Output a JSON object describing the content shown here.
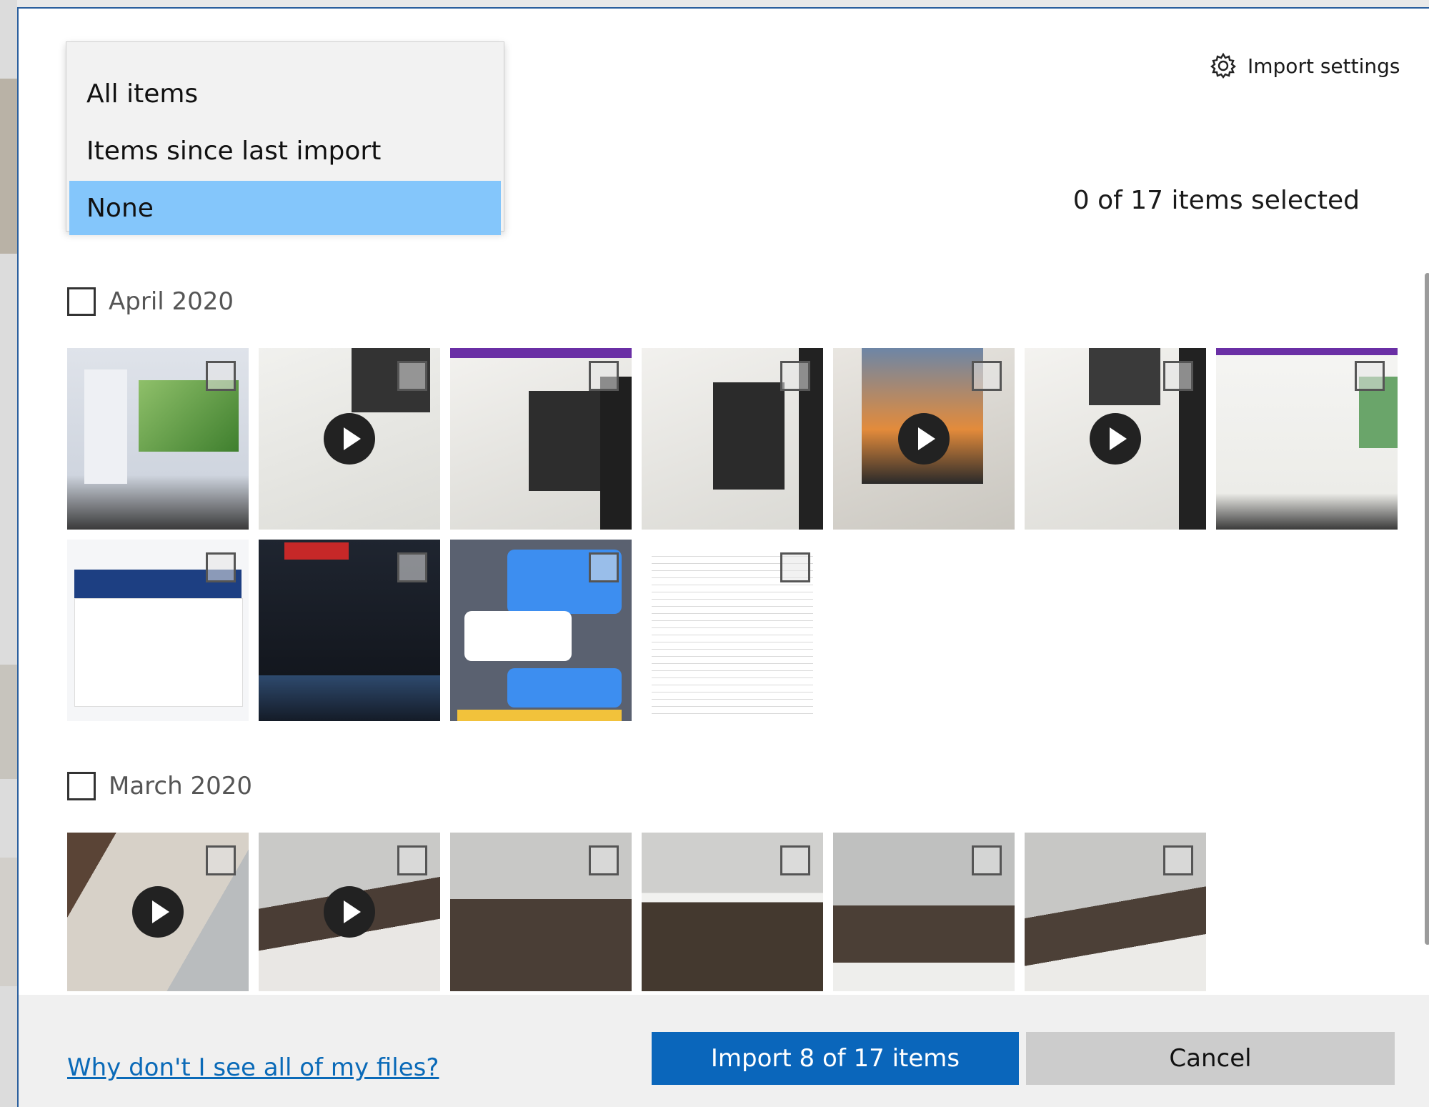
{
  "dropdown": {
    "options": [
      {
        "label": "All items",
        "selected": false
      },
      {
        "label": "Items since last import",
        "selected": false
      },
      {
        "label": "None",
        "selected": true
      }
    ]
  },
  "header": {
    "settings_label": "Import settings",
    "selection_count": "0 of 17 items selected"
  },
  "groups": [
    {
      "label": "April 2020",
      "checked": false
    },
    {
      "label": "March 2020",
      "checked": false
    }
  ],
  "footer": {
    "help_link": "Why don't I see all of my files?",
    "import_button": "Import 8 of 17 items",
    "cancel_button": "Cancel"
  },
  "thumbnails": {
    "april": [
      {
        "type": "photo",
        "checked": false
      },
      {
        "type": "video",
        "checked": false
      },
      {
        "type": "photo",
        "checked": false
      },
      {
        "type": "photo",
        "checked": false
      },
      {
        "type": "video",
        "checked": false
      },
      {
        "type": "video",
        "checked": false
      },
      {
        "type": "photo",
        "checked": false
      },
      {
        "type": "photo",
        "checked": false
      },
      {
        "type": "photo",
        "checked": false
      },
      {
        "type": "photo",
        "checked": false
      },
      {
        "type": "photo",
        "checked": false
      }
    ],
    "march": [
      {
        "type": "video",
        "checked": false
      },
      {
        "type": "video",
        "checked": false
      },
      {
        "type": "photo",
        "checked": false
      },
      {
        "type": "photo",
        "checked": false
      },
      {
        "type": "photo",
        "checked": false
      },
      {
        "type": "photo",
        "checked": false
      }
    ]
  },
  "colors": {
    "accent": "#0a66bb",
    "highlight": "#84c6fb",
    "link": "#0a6ab8"
  }
}
